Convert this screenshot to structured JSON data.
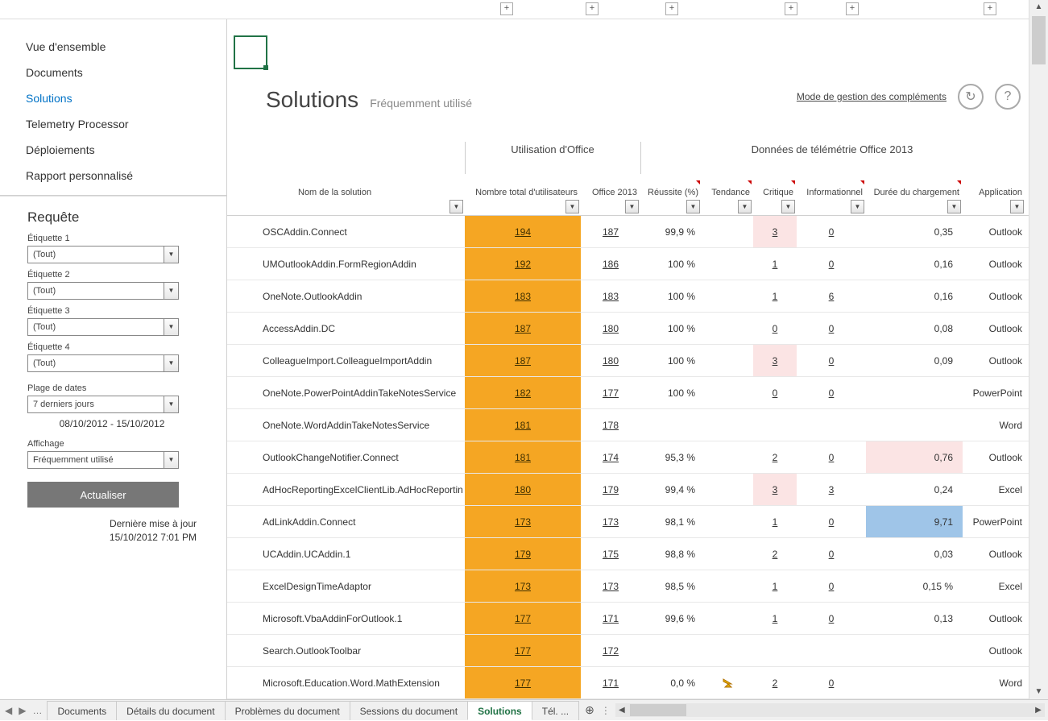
{
  "expand_buttons_x": [
    621,
    727,
    826,
    974,
    1050,
    1221
  ],
  "sidebar": {
    "nav": [
      "Vue d'ensemble",
      "Documents",
      "Solutions",
      "Telemetry Processor",
      "Déploiements",
      "Rapport personnalisé"
    ],
    "active_index": 2,
    "query_title": "Requête",
    "labels": {
      "etq1": "Étiquette 1",
      "etq2": "Étiquette 2",
      "etq3": "Étiquette 3",
      "etq4": "Étiquette 4",
      "daterange": "Plage de dates",
      "display": "Affichage"
    },
    "values": {
      "etq1": "(Tout)",
      "etq2": "(Tout)",
      "etq3": "(Tout)",
      "etq4": "(Tout)",
      "daterange": "7 derniers jours",
      "display": "Fréquemment utilisé"
    },
    "daterange_text": "08/10/2012 - 15/10/2012",
    "refresh": "Actualiser",
    "last_update_label": "Dernière mise à jour",
    "last_update_value": "15/10/2012 7:01 PM"
  },
  "header": {
    "title": "Solutions",
    "subtitle": "Fréquemment utilisé",
    "link": "Mode de gestion des compléments"
  },
  "groups": {
    "g1": "Utilisation d'Office",
    "g2": "Données de télémétrie Office 2013"
  },
  "columns": {
    "name": "Nom de la solution",
    "total": "Nombre total d'utilisateurs",
    "o2013": "Office 2013",
    "succ": "Réussite (%)",
    "trend": "Tendance",
    "crit": "Critique",
    "info": "Informationnel",
    "load": "Durée du chargement",
    "app": "Application"
  },
  "rows": [
    {
      "name": "OSCAddin.Connect",
      "total": "194",
      "o2013": "187",
      "succ": "99,9 %",
      "crit": "3",
      "crit_hl": true,
      "info": "0",
      "load": "0,35",
      "app": "Outlook"
    },
    {
      "name": "UMOutlookAddin.FormRegionAddin",
      "total": "192",
      "o2013": "186",
      "succ": "100 %",
      "crit": "1",
      "info": "0",
      "load": "0,16",
      "app": "Outlook"
    },
    {
      "name": "OneNote.OutlookAddin",
      "total": "183",
      "o2013": "183",
      "succ": "100 %",
      "crit": "1",
      "info": "6",
      "load": "0,16",
      "app": "Outlook"
    },
    {
      "name": "AccessAddin.DC",
      "total": "187",
      "o2013": "180",
      "succ": "100 %",
      "crit": "0",
      "info": "0",
      "load": "0,08",
      "app": "Outlook"
    },
    {
      "name": "ColleagueImport.ColleagueImportAddin",
      "total": "187",
      "o2013": "180",
      "succ": "100 %",
      "crit": "3",
      "crit_hl": true,
      "info": "0",
      "load": "0,09",
      "app": "Outlook"
    },
    {
      "name": "OneNote.PowerPointAddinTakeNotesService",
      "total": "182",
      "o2013": "177",
      "succ": "100 %",
      "crit": "0",
      "info": "0",
      "load": "",
      "app": "PowerPoint"
    },
    {
      "name": "OneNote.WordAddinTakeNotesService",
      "total": "181",
      "o2013": "178",
      "succ": "",
      "crit": "",
      "info": "",
      "load": "",
      "app": "Word"
    },
    {
      "name": "OutlookChangeNotifier.Connect",
      "total": "181",
      "o2013": "174",
      "succ": "95,3 %",
      "crit": "2",
      "info": "0",
      "load": "0,76",
      "load_hl": true,
      "app": "Outlook"
    },
    {
      "name": "AdHocReportingExcelClientLib.AdHocReportingExcelClientAddIn",
      "total": "180",
      "o2013": "179",
      "succ": "99,4 %",
      "crit": "3",
      "crit_hl": true,
      "info": "3",
      "load": "0,24",
      "app": "Excel"
    },
    {
      "name": "AdLinkAddin.Connect",
      "total": "173",
      "o2013": "173",
      "succ": "98,1 %",
      "crit": "1",
      "info": "0",
      "load": "9,71",
      "load_blue": true,
      "app": "PowerPoint"
    },
    {
      "name": "UCAddin.UCAddin.1",
      "total": "179",
      "o2013": "175",
      "succ": "98,8 %",
      "crit": "2",
      "info": "0",
      "load": "0,03",
      "app": "Outlook"
    },
    {
      "name": "ExcelDesignTimeAdaptor",
      "total": "173",
      "o2013": "173",
      "succ": "98,5 %",
      "crit": "1",
      "info": "0",
      "load": "0,15 %",
      "app": "Excel"
    },
    {
      "name": "Microsoft.VbaAddinForOutlook.1",
      "total": "177",
      "o2013": "171",
      "succ": "99,6 %",
      "crit": "1",
      "info": "0",
      "load": "0,13",
      "app": "Outlook"
    },
    {
      "name": "Search.OutlookToolbar",
      "total": "177",
      "o2013": "172",
      "succ": "",
      "crit": "",
      "info": "",
      "load": "",
      "app": "Outlook"
    },
    {
      "name": "Microsoft.Education.Word.MathExtension",
      "total": "177",
      "o2013": "171",
      "succ": "0,0 %",
      "trend": "down",
      "crit": "2",
      "info": "0",
      "load": "",
      "app": "Word"
    }
  ],
  "tabs": [
    "Documents",
    "Détails du document",
    "Problèmes du document",
    "Sessions du document",
    "Solutions",
    "Tél.   ..."
  ],
  "active_tab_index": 4
}
